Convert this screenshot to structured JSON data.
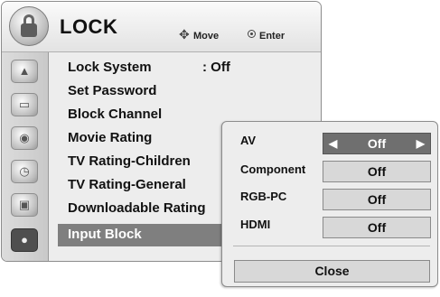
{
  "header": {
    "title": "LOCK",
    "hint_move": "Move",
    "hint_enter": "Enter",
    "icon": "lock-icon"
  },
  "sidebar": {
    "icons": [
      "picture-icon",
      "screen-icon",
      "audio-icon",
      "time-icon",
      "option-icon",
      "lock-icon"
    ],
    "active_index": 5
  },
  "menu": {
    "items": [
      "Lock System",
      "Set Password",
      "Block Channel",
      "Movie Rating",
      "TV Rating-Children",
      "TV Rating-General",
      "Downloadable Rating",
      "Input Block"
    ],
    "lock_system_value": ": Off",
    "selected_index": 7
  },
  "popup": {
    "rows": [
      {
        "label": "AV",
        "value": "Off"
      },
      {
        "label": "Component",
        "value": "Off"
      },
      {
        "label": "RGB-PC",
        "value": "Off"
      },
      {
        "label": "HDMI",
        "value": "Off"
      }
    ],
    "active_row": 0,
    "close_label": "Close"
  },
  "colors": {
    "panel": "#ededed",
    "selected": "#7f7f7f",
    "value_box": "#d8d8d8"
  }
}
